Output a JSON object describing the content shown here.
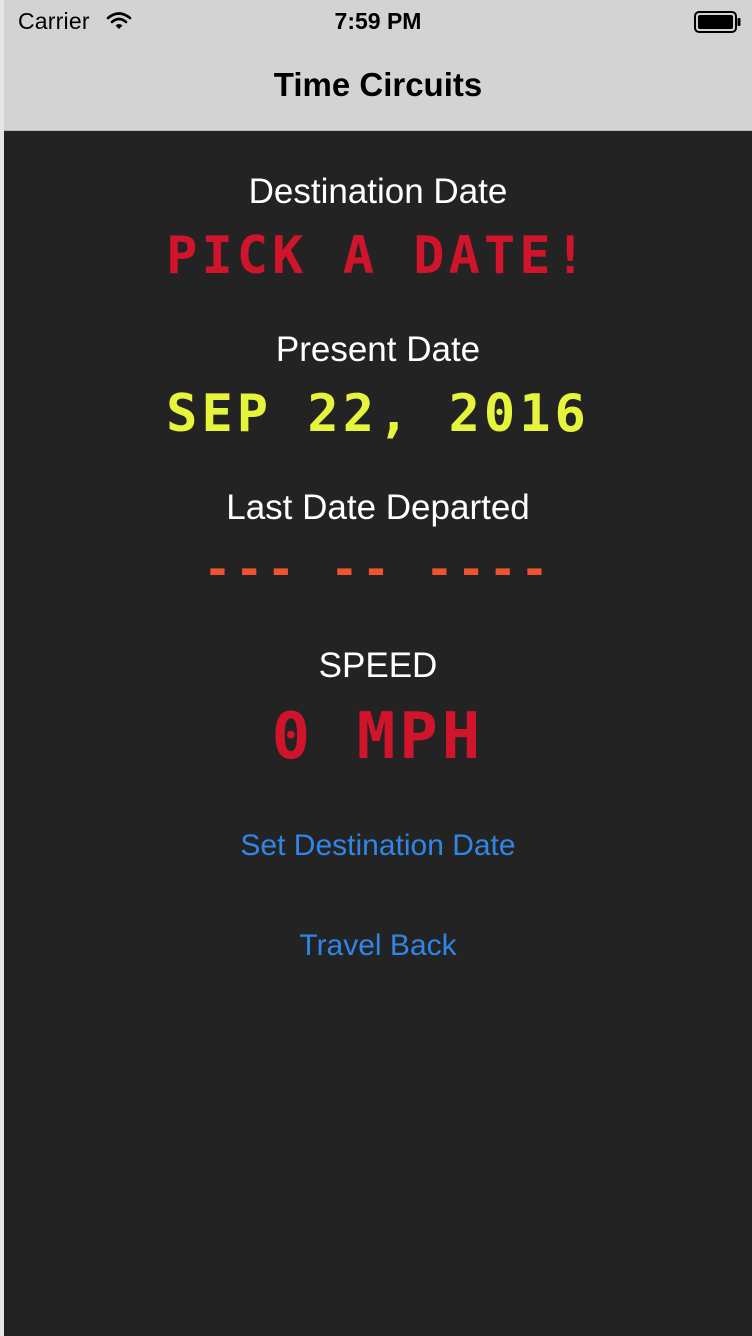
{
  "status_bar": {
    "carrier": "Carrier",
    "time": "7:59 PM",
    "wifi_icon": "wifi-icon",
    "battery_icon": "battery-icon"
  },
  "nav": {
    "title": "Time Circuits"
  },
  "destination": {
    "label": "Destination Date",
    "value": "PICK A DATE!",
    "color": "#d0142c"
  },
  "present": {
    "label": "Present Date",
    "value": "SEP 22, 2016",
    "color": "#e6f53b"
  },
  "last_departed": {
    "label": "Last Date Departed",
    "value": "--- -- ----",
    "color": "#f0532f"
  },
  "speed": {
    "label": "SPEED",
    "value": "0 MPH",
    "color": "#d0142c"
  },
  "actions": {
    "set_destination_label": "Set Destination Date",
    "travel_back_label": "Travel Back",
    "link_color": "#2f86e6"
  },
  "colors": {
    "background": "#232323",
    "bars": "#d3d3d3"
  }
}
